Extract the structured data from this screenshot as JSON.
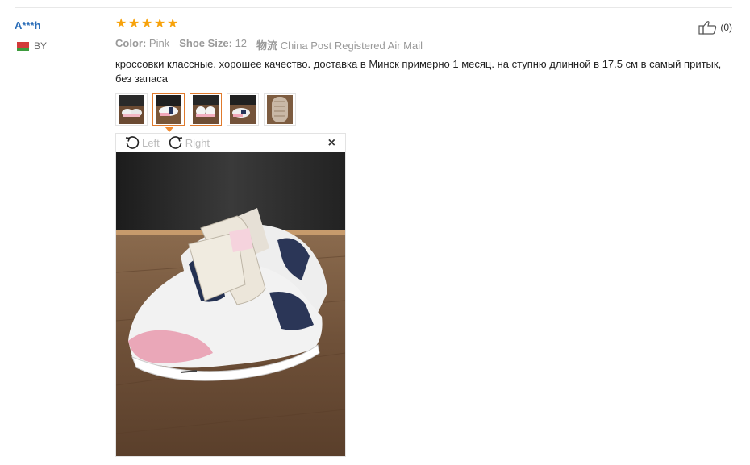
{
  "user": {
    "name": "A***h",
    "country": "BY"
  },
  "rating": {
    "stars": 5,
    "max": 5
  },
  "helpful": {
    "count": "(0)"
  },
  "specs": [
    {
      "key": "Color:",
      "value": "Pink"
    },
    {
      "key": "Shoe Size:",
      "value": "12"
    },
    {
      "key": "物流",
      "value": "China Post Registered Air Mail"
    }
  ],
  "review_text": "кроссовки классные. хорошее качество. доставка в Минск примерно 1 месяц. на ступню длинной в 17.5 см в самый притык, без запаса",
  "thumbnails": {
    "count": 5,
    "selected_indices": [
      1,
      2
    ]
  },
  "viewer": {
    "rotate_left_label": "Left",
    "rotate_right_label": "Right",
    "close_label": "×"
  },
  "colors": {
    "accent": "#f7a20b",
    "username": "#2a6db8",
    "selected_border": "#e07a2c"
  }
}
